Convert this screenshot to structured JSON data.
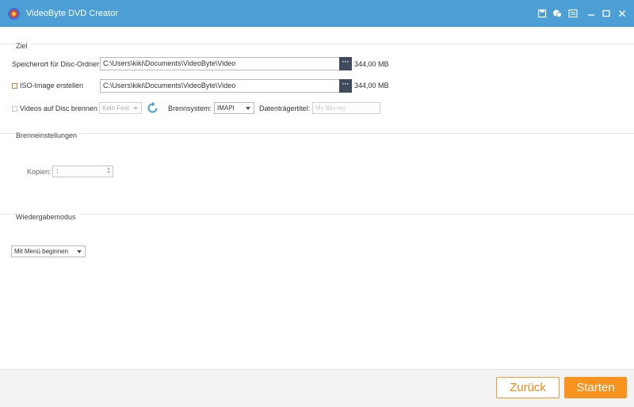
{
  "app": {
    "title": "VideoByte DVD Creator",
    "accent_color": "#4c9fd4",
    "titlebar_icons": [
      "save-icon",
      "feedback-icon",
      "menu-icon",
      "minimize-icon",
      "maximize-icon",
      "close-icon"
    ]
  },
  "ziel": {
    "section_label": "Ziel",
    "folder_label": "Speicherort für Disc-Ordner:",
    "folder_path": "C:\\Users\\kiki\\Documents\\VideoByte\\Video",
    "folder_size": "344,00 MB",
    "iso_label": "ISO-Image erstellen",
    "iso_path": "C:\\Users\\kiki\\Documents\\VideoByte\\Video",
    "iso_size": "344,00 MB",
    "browse_label": "···",
    "burn_label": "Videos auf Disc brennen",
    "burn_drive": "Kein Fest",
    "brennsystem_label": "Brennsystem:",
    "brennsystem_value": "IMAPI",
    "disc_title_label": "Datenträgertitel:",
    "disc_title_placeholder": "My Blu-ray"
  },
  "brenneinstellungen": {
    "section_label": "Brenneinstellungen",
    "copies_label": "Kopien:",
    "copies_value": "1"
  },
  "wiedergabe": {
    "section_label": "Wiedergabemodus",
    "mode_value": "Mit Menü beginnen"
  },
  "footer": {
    "back_label": "Zurück",
    "start_label": "Starten",
    "start_color": "#f7931e"
  }
}
